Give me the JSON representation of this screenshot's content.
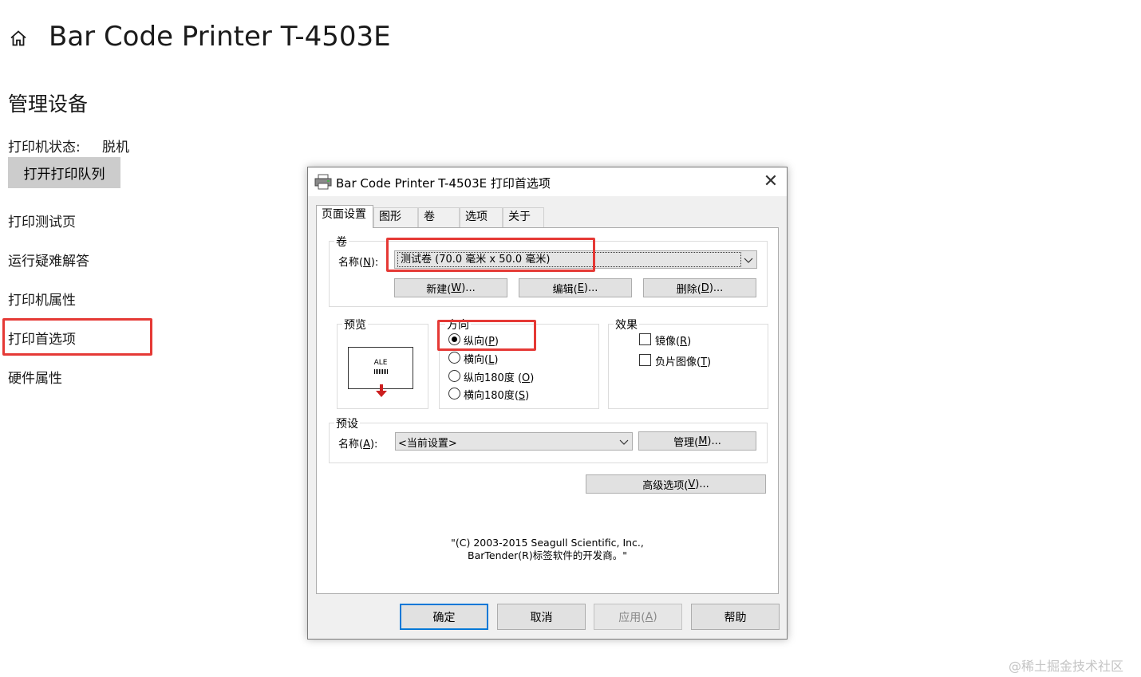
{
  "header": {
    "icon": "home-icon",
    "title": "Bar Code Printer T-4503E"
  },
  "manage": {
    "title": "管理设备",
    "status_label": "打印机状态:",
    "status_value": "脱机",
    "open_queue_button": "打开打印队列",
    "links": [
      "打印测试页",
      "运行疑难解答",
      "打印机属性",
      "打印首选项",
      "硬件属性"
    ]
  },
  "dialog": {
    "title": "Bar Code Printer T-4503E 打印首选项",
    "icon": "printer-icon",
    "close": "✕",
    "tabs": [
      "页面设置",
      "图形",
      "卷",
      "选项",
      "关于"
    ],
    "active_tab": "页面设置",
    "stock": {
      "legend": "卷",
      "name_label": "名称(",
      "name_key": "N",
      "name_end": "):",
      "name_value": "测试卷 (70.0 毫米 x 50.0 毫米)",
      "buttons": [
        {
          "text": "新建(",
          "key": "W",
          "end": ")..."
        },
        {
          "text": "编辑(",
          "key": "E",
          "end": ")..."
        },
        {
          "text": "删除(",
          "key": "D",
          "end": ")..."
        }
      ]
    },
    "preview": {
      "legend": "预览",
      "sample_text": "ALE"
    },
    "orientation": {
      "legend": "方向",
      "options": [
        {
          "text": "纵向(",
          "key": "P",
          "end": ")",
          "selected": true
        },
        {
          "text": "横向(",
          "key": "L",
          "end": ")",
          "selected": false
        },
        {
          "text": "纵向180度 (",
          "key": "O",
          "end": ")",
          "selected": false
        },
        {
          "text": "横向180度(",
          "key": "S",
          "end": ")",
          "selected": false
        }
      ]
    },
    "effects": {
      "legend": "效果",
      "options": [
        {
          "text": "镜像(",
          "key": "R",
          "end": ")",
          "checked": false
        },
        {
          "text": "负片图像(",
          "key": "T",
          "end": ")",
          "checked": false
        }
      ]
    },
    "preset": {
      "legend": "预设",
      "name_label": "名称(",
      "name_key": "A",
      "name_end": "):",
      "name_value": "<当前设置>",
      "manage_button": {
        "text": "管理(",
        "key": "M",
        "end": ")..."
      }
    },
    "advanced_button": {
      "text": "高级选项(",
      "key": "V",
      "end": ")..."
    },
    "copyright_line1": "\"(C) 2003-2015 Seagull Scientific, Inc.,",
    "copyright_line2": "BarTender(R)标签软件的开发商。\"",
    "footer_buttons": [
      {
        "text": "确定",
        "key": "",
        "end": "",
        "default": true,
        "disabled": false
      },
      {
        "text": "取消",
        "key": "",
        "end": "",
        "default": false,
        "disabled": false
      },
      {
        "text": "应用(",
        "key": "A",
        "end": ")",
        "default": false,
        "disabled": true
      },
      {
        "text": "帮助",
        "key": "",
        "end": "",
        "default": false,
        "disabled": false
      }
    ]
  },
  "watermark": "@稀土掘金技术社区",
  "colors": {
    "highlight_red": "#e53935",
    "focus_blue": "#0078d7",
    "button_gray": "#cccccc"
  }
}
